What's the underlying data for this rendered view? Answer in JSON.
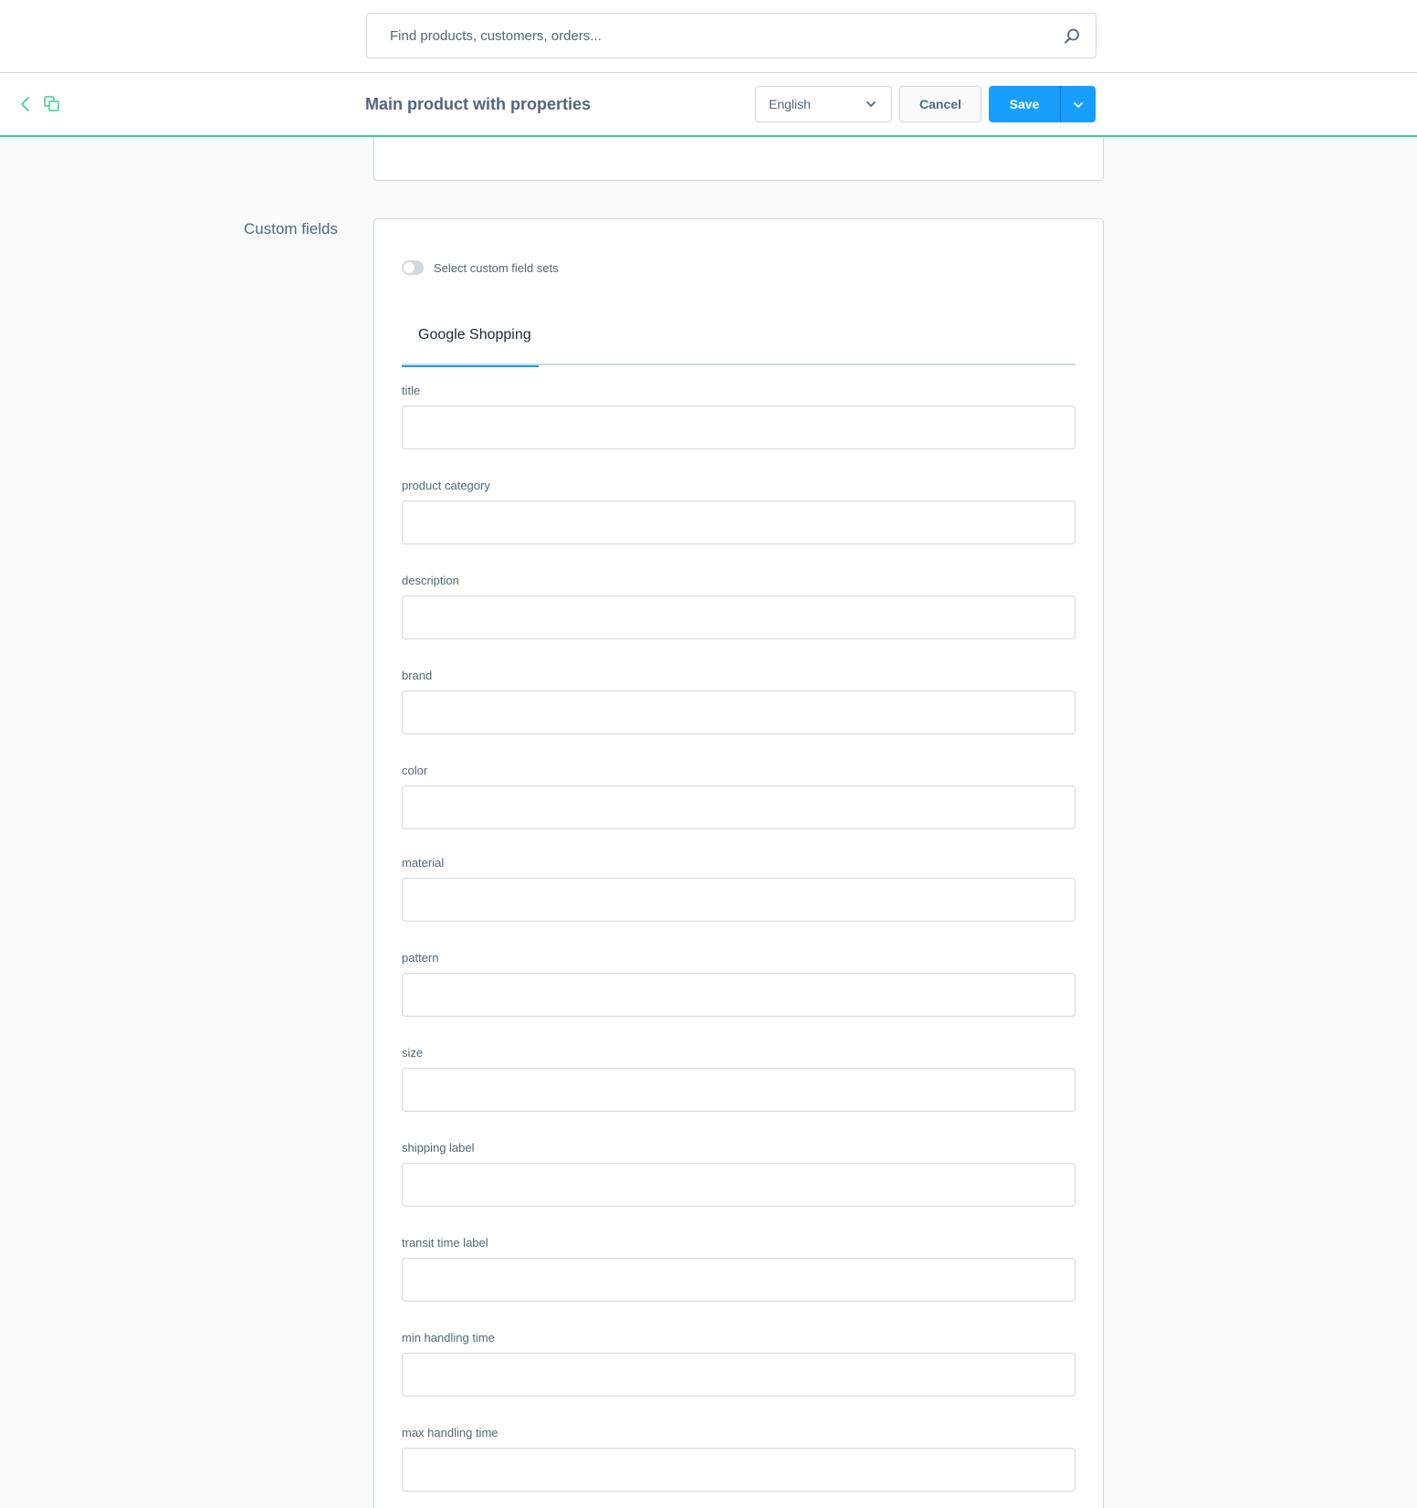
{
  "search": {
    "placeholder": "Find products, customers, orders..."
  },
  "smart_bar": {
    "title": "Main product with properties",
    "language": "English",
    "cancel_label": "Cancel",
    "save_label": "Save"
  },
  "custom_fields": {
    "section_title": "Custom fields",
    "switch_label": "Select custom field sets",
    "switch_on": false,
    "tab_label": "Google Shopping",
    "fields": [
      "title",
      "product category",
      "description",
      "brand",
      "color",
      "material",
      "pattern",
      "size",
      "shipping label",
      "transit time label",
      "min handling time",
      "max handling time"
    ]
  },
  "colors": {
    "accent": "#189eff",
    "smart_bar_border": "#37d18f",
    "text": "#52667a",
    "border": "#d1d9e0"
  }
}
